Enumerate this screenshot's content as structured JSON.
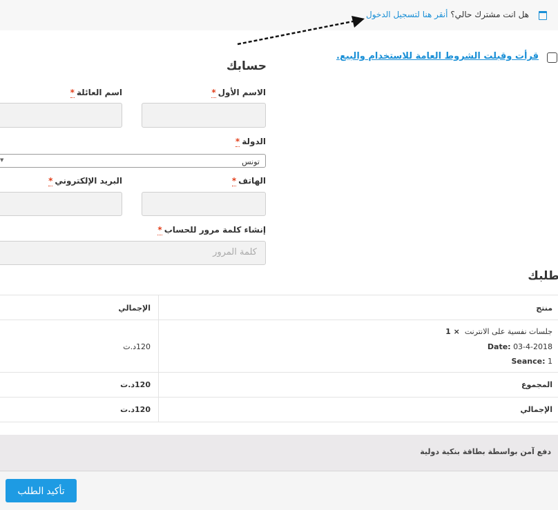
{
  "login_notice": {
    "question": "هل انت مشترك حالي؟",
    "link": "أنقر هنا لتسجيل الدخول"
  },
  "terms": {
    "label": "قرأت وقبلت الشروط العامة للاستخدام والبيع."
  },
  "account": {
    "title": "حسابك",
    "first_name_label": "الاسم الأول",
    "last_name_label": "اسم العائلة",
    "country_label": "الدولة",
    "country_value": "تونس",
    "phone_label": "الهاتف",
    "email_label": "البريد الإلكتروني",
    "password_label": "إنشاء كلمة مرور للحساب",
    "password_placeholder": "كلمة المرور",
    "required_mark": "*"
  },
  "order": {
    "title": "طلبك",
    "headers": {
      "product": "منتج",
      "total": "الإجمالي"
    },
    "item": {
      "name": "جلسات نفسية على الانترنت",
      "qty": "× 1",
      "date_label": "Date:",
      "date_value": "03-4-2018",
      "seance_label": "Seance:",
      "seance_value": "1",
      "price": "120د.ت"
    },
    "subtotal_label": "المجموع",
    "subtotal_value": "120د.ت",
    "total_label": "الإجمالي",
    "total_value": "120د.ت"
  },
  "payment": {
    "method": "دفع آمن بواسطة بطاقة بنكية دولية"
  },
  "confirm_button": "تأكيد الطلب",
  "colors": {
    "accent": "#1e9be3",
    "link": "#1a8fd6",
    "required": "#e2401c"
  }
}
